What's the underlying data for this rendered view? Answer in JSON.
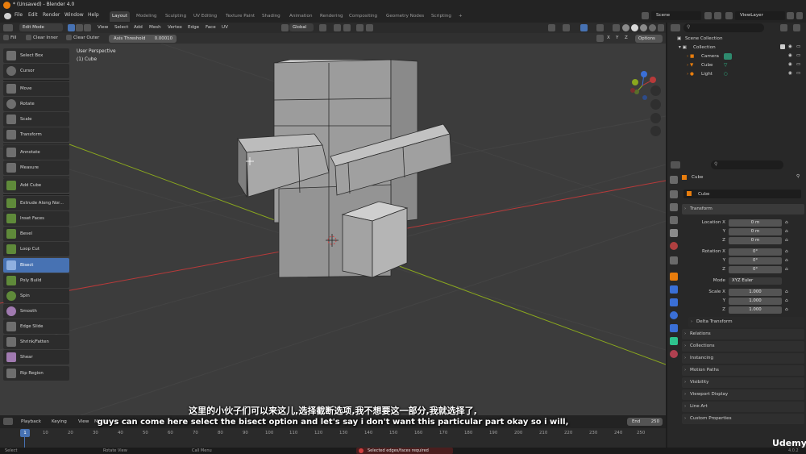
{
  "app": {
    "title": "* (Unsaved) - Blender 4.0"
  },
  "menu": [
    "File",
    "Edit",
    "Render",
    "Window",
    "Help"
  ],
  "workspaces": [
    "Layout",
    "Modeling",
    "Sculpting",
    "UV Editing",
    "Texture Paint",
    "Shading",
    "Animation",
    "Rendering",
    "Compositing",
    "Geometry Nodes",
    "Scripting",
    "+"
  ],
  "scene": {
    "label": "Scene",
    "view_layer": "ViewLayer"
  },
  "vp_header": {
    "mode": "Edit Mode",
    "menus": [
      "View",
      "Select",
      "Add",
      "Mesh",
      "Vertex",
      "Edge",
      "Face",
      "UV"
    ],
    "orientation": "Global",
    "options": "Options",
    "axes": [
      "X",
      "Y",
      "Z"
    ]
  },
  "tool_settings": {
    "fill": "Fill",
    "clear_inner": "Clear Inner",
    "clear_outer": "Clear Outer",
    "axis_threshold_label": "Axis Threshold",
    "axis_threshold_value": "0.00010"
  },
  "overlay": {
    "perspective": "User Perspective",
    "object": "(1) Cube"
  },
  "tools": [
    "Select Box",
    "Cursor",
    "Move",
    "Rotate",
    "Scale",
    "Transform",
    "Annotate",
    "Measure",
    "Add Cube",
    "Extrude Along Nor...",
    "Inset Faces",
    "Bevel",
    "Loop Cut",
    "Bisect",
    "Poly Build",
    "Spin",
    "Smooth",
    "Edge Slide",
    "Shrink/Fatten",
    "Shear",
    "Rip Region"
  ],
  "active_tool": "Bisect",
  "outliner": {
    "scene_collection": "Scene Collection",
    "collection": "Collection",
    "items": [
      "Camera",
      "Cube",
      "Light"
    ]
  },
  "props": {
    "object_name": "Cube",
    "mesh_name": "Cube",
    "transform": "Transform",
    "location": {
      "label": "Location X",
      "y": "Y",
      "z": "Z",
      "values": [
        "0 m",
        "0 m",
        "0 m"
      ]
    },
    "rotation": {
      "label": "Rotation X",
      "y": "Y",
      "z": "Z",
      "values": [
        "0°",
        "0°",
        "0°"
      ]
    },
    "mode_label": "Mode",
    "mode_value": "XYZ Euler",
    "scale": {
      "label": "Scale X",
      "y": "Y",
      "z": "Z",
      "values": [
        "1.000",
        "1.000",
        "1.000"
      ]
    },
    "delta": "Delta Transform",
    "sections": [
      "Relations",
      "Collections",
      "Instancing",
      "Motion Paths",
      "Visibility",
      "Viewport Display",
      "Line Art",
      "Custom Properties"
    ]
  },
  "timeline": {
    "menus": [
      "Playback",
      "Keying",
      "View",
      "Marker"
    ],
    "current": "1",
    "end_label": "End",
    "end_value": "250",
    "ticks": [
      "10",
      "20",
      "30",
      "40",
      "50",
      "60",
      "70",
      "80",
      "90",
      "100",
      "110",
      "120",
      "130",
      "140",
      "150",
      "160",
      "170",
      "180",
      "190",
      "200",
      "210",
      "220",
      "230",
      "240",
      "250"
    ]
  },
  "status": {
    "select": "Select",
    "rotate": "Rotate View",
    "menu": "Call Menu",
    "warning": "Selected edges/faces required",
    "version": "4.0.2"
  },
  "subtitles": {
    "zh": "这里的小伙子们可以来这儿,选择截断选项,我不想要这一部分,我就选择了,",
    "en": "guys can come here select the bisect option and let's say i don't want this particular part okay so i will,"
  },
  "watermark": "Udemy",
  "colors": {
    "accent": "#4772b3",
    "x_axis": "#b83a3a",
    "y_axis": "#8aa71e",
    "z_axis": "#3a6fd6"
  }
}
